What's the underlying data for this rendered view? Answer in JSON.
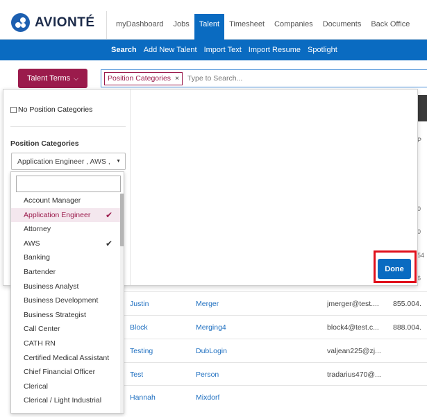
{
  "app": {
    "logo_text": "AVIONTÉ"
  },
  "nav": {
    "items": [
      {
        "label": "myDashboard",
        "active": false
      },
      {
        "label": "Jobs",
        "active": false
      },
      {
        "label": "Talent",
        "active": true
      },
      {
        "label": "Timesheet",
        "active": false
      },
      {
        "label": "Companies",
        "active": false
      },
      {
        "label": "Documents",
        "active": false
      },
      {
        "label": "Back Office",
        "active": false
      }
    ]
  },
  "subnav": {
    "items": [
      {
        "label": "Search",
        "active": true
      },
      {
        "label": "Add New Talent",
        "active": false
      },
      {
        "label": "Import Text",
        "active": false
      },
      {
        "label": "Import Resume",
        "active": false
      },
      {
        "label": "Spotlight",
        "active": false
      }
    ]
  },
  "search": {
    "terms_button": "Talent Terms",
    "chip_label": "Position Categories",
    "chip_remove": "×",
    "placeholder": "Type to Search..."
  },
  "filter": {
    "no_position_label": "No Position Categories",
    "section_label": "Position Categories",
    "select_value": "Application Engineer , AWS ,",
    "done_label": "Done"
  },
  "dropdown": {
    "options": [
      {
        "label": "Account Manager",
        "selected": false,
        "active": false
      },
      {
        "label": "Application Engineer",
        "selected": true,
        "active": true
      },
      {
        "label": "Attorney",
        "selected": false,
        "active": false
      },
      {
        "label": "AWS",
        "selected": true,
        "active": false
      },
      {
        "label": "Banking",
        "selected": false,
        "active": false
      },
      {
        "label": "Bartender",
        "selected": false,
        "active": false
      },
      {
        "label": "Business Analyst",
        "selected": false,
        "active": false
      },
      {
        "label": "Business Development",
        "selected": false,
        "active": false
      },
      {
        "label": "Business Strategist",
        "selected": false,
        "active": false
      },
      {
        "label": "Call Center",
        "selected": false,
        "active": false
      },
      {
        "label": "CATH RN",
        "selected": false,
        "active": false
      },
      {
        "label": "Certified Medical Assistant",
        "selected": false,
        "active": false
      },
      {
        "label": "Chief Financial Officer",
        "selected": false,
        "active": false
      },
      {
        "label": "Clerical",
        "selected": false,
        "active": false
      },
      {
        "label": "Clerical / Light Industrial",
        "selected": false,
        "active": false
      }
    ]
  },
  "results": {
    "rows": [
      {
        "first": "Justin",
        "last": "Merger",
        "email": "jmerger@test....",
        "phone": "855.004."
      },
      {
        "first": "Block",
        "last": "Merging4",
        "email": "block4@test.c...",
        "phone": "888.004."
      },
      {
        "first": "Testing",
        "last": "DubLogin",
        "email": "valjean225@zj...",
        "phone": ""
      },
      {
        "first": "Test",
        "last": "Person",
        "email": "tradarius470@...",
        "phone": ""
      },
      {
        "first": "Hannah",
        "last": "Mixdorf",
        "email": "",
        "phone": ""
      }
    ],
    "edge_glyphs": [
      "P",
      "0",
      "0",
      "54",
      "6"
    ]
  },
  "colors": {
    "brand_blue": "#0a6bc1",
    "accent_maroon": "#9b1b4c",
    "highlight_red": "#e0101c"
  }
}
